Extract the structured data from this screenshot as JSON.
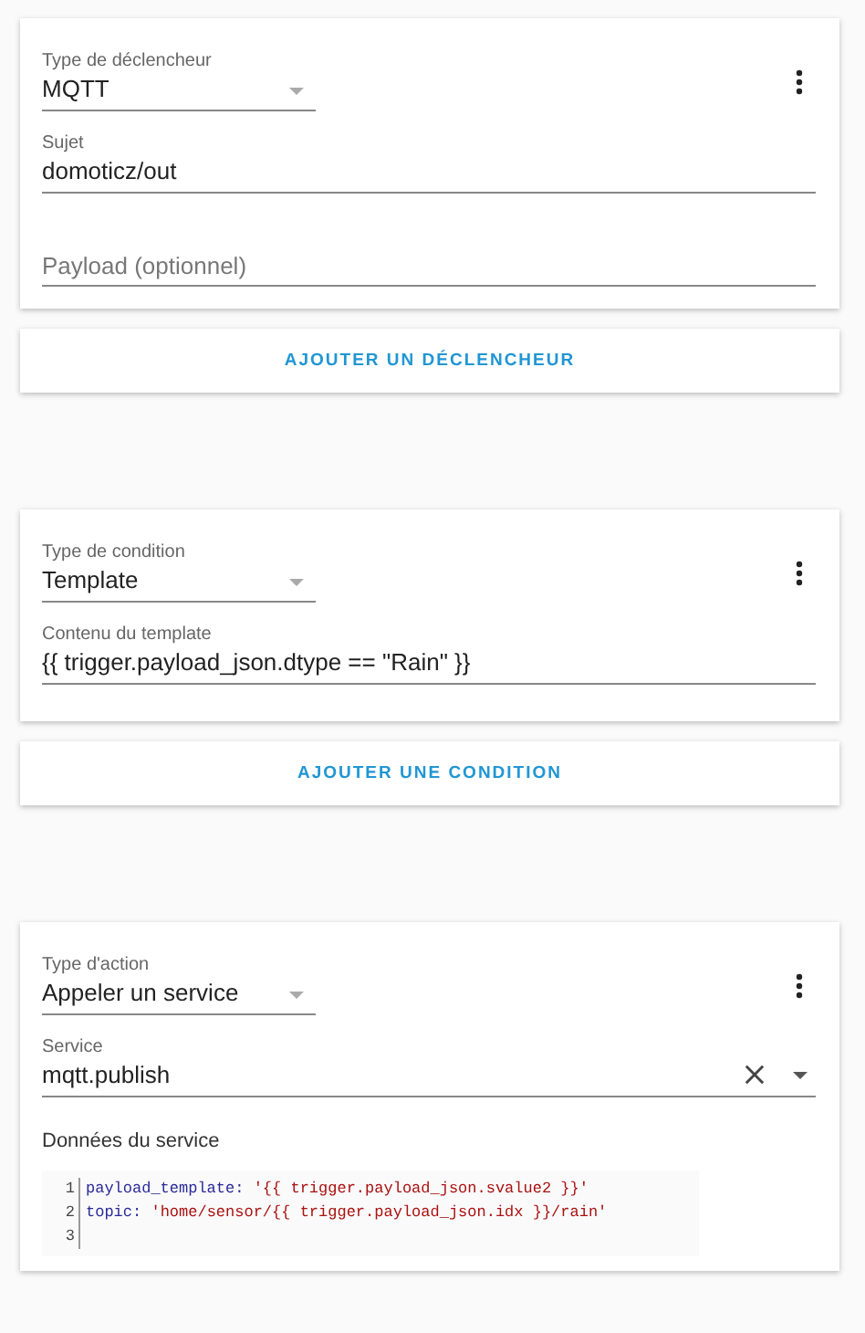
{
  "sections": [
    {
      "card": {
        "fields": [
          {
            "kind": "select",
            "label": "Type de déclencheur",
            "value": "MQTT"
          },
          {
            "kind": "text",
            "label": "Sujet",
            "value": "domoticz/out"
          },
          {
            "kind": "text",
            "placeholder": "Payload (optionnel)"
          }
        ]
      },
      "add_button": "AJOUTER UN DÉCLENCHEUR"
    },
    {
      "card": {
        "fields": [
          {
            "kind": "select",
            "label": "Type de condition",
            "value": "Template"
          },
          {
            "kind": "text",
            "label": "Contenu du template",
            "value": "{{ trigger.payload_json.dtype == \"Rain\" }}"
          }
        ]
      },
      "add_button": "AJOUTER UNE CONDITION"
    },
    {
      "card": {
        "fields": [
          {
            "kind": "select",
            "label": "Type d'action",
            "value": "Appeler un service"
          },
          {
            "kind": "combo",
            "label": "Service",
            "value": "mqtt.publish"
          },
          {
            "kind": "code",
            "label": "Données du service",
            "lines": [
              {
                "number": "1",
                "key": "payload_template:",
                "value": "'{{ trigger.payload_json.svalue2 }}'"
              },
              {
                "number": "2",
                "key": "topic:",
                "value": "'home/sensor/{{ trigger.payload_json.idx }}/rain'"
              },
              {
                "number": "3"
              }
            ]
          }
        ]
      }
    }
  ]
}
